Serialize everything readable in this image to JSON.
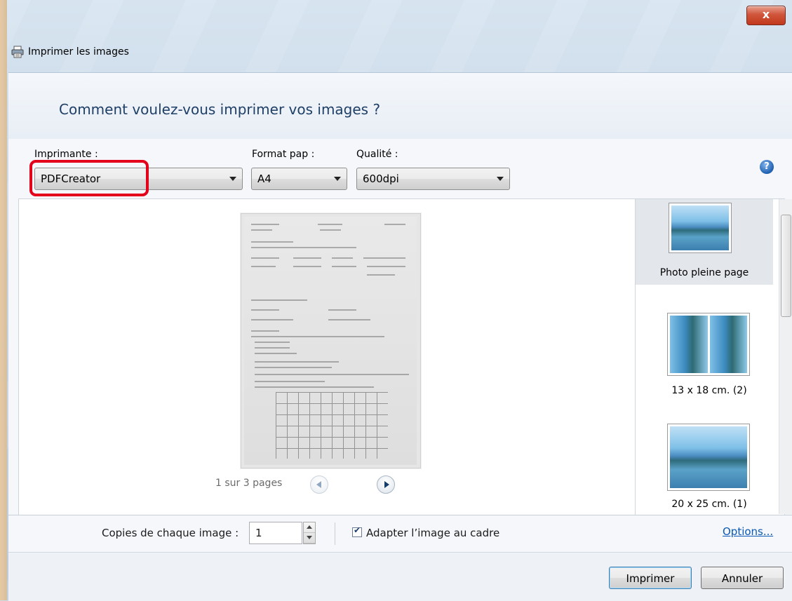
{
  "window": {
    "title": "Imprimer les images",
    "close_label": "x",
    "question": "Comment voulez-vous imprimer vos images ?"
  },
  "settings": {
    "printer": {
      "label": "Imprimante :",
      "value": "PDFCreator"
    },
    "paper": {
      "label": "Format pap :",
      "value": "A4"
    },
    "quality": {
      "label": "Qualité :",
      "value": "600dpi"
    },
    "help_glyph": "?"
  },
  "preview": {
    "page_indicator": "1 sur 3 pages"
  },
  "layouts": [
    {
      "label": "Photo pleine page",
      "selected": true
    },
    {
      "label": "13 x 18 cm. (2)",
      "selected": false
    },
    {
      "label": "20 x 25 cm. (1)",
      "selected": false
    }
  ],
  "copies": {
    "label": "Copies de chaque image :",
    "value": "1"
  },
  "fit": {
    "label": "Adapter l’image au cadre",
    "checked": true
  },
  "options_label": "Options...",
  "buttons": {
    "print": "Imprimer",
    "cancel": "Annuler"
  },
  "colors": {
    "highlight": "#e4001b",
    "link": "#0a58b4",
    "heading": "#1e3f66"
  }
}
